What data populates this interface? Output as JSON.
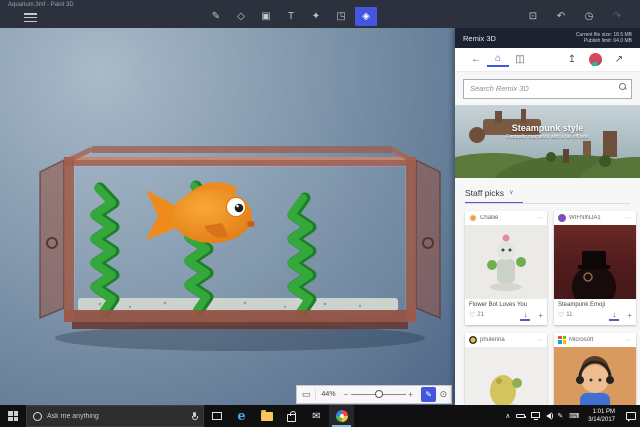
{
  "colors": {
    "accent": "#4456e0",
    "panel_accent": "#6454c8",
    "taskbar_active": "#76b9ed"
  },
  "window": {
    "title": "Aquarium.3mf - Paint 3D"
  },
  "topbar": {
    "tools": [
      {
        "name": "art-tools",
        "glyph": "✎",
        "active": false
      },
      {
        "name": "3d-shapes",
        "glyph": "◇",
        "active": false
      },
      {
        "name": "stickers",
        "glyph": "▣",
        "active": false
      },
      {
        "name": "text",
        "glyph": "T",
        "active": false
      },
      {
        "name": "effects",
        "glyph": "✦",
        "active": false
      },
      {
        "name": "canvas",
        "glyph": "◳",
        "active": false
      },
      {
        "name": "remix-3d",
        "glyph": "◈",
        "active": true
      }
    ],
    "actions": [
      {
        "name": "paste",
        "glyph": "⊡"
      },
      {
        "name": "undo",
        "glyph": "↶"
      },
      {
        "name": "history",
        "glyph": "◷"
      },
      {
        "name": "redo",
        "glyph": "↷"
      }
    ]
  },
  "canvas": {
    "zoom": "44%"
  },
  "zoombar": {
    "fit": "▭",
    "minus": "−",
    "plus": "+",
    "pencil": "✎",
    "eye": "⊙"
  },
  "remix": {
    "header": {
      "title": "Remix 3D",
      "file_size": "Current file size: 18.5 MB",
      "publish_limit": "Publish limit: 64.0 MB"
    },
    "nav": {
      "back": "←",
      "home": "⌂",
      "boards": "◫",
      "upload": "↥",
      "popout": "↗"
    },
    "search": {
      "placeholder": "Search Remix 3D"
    },
    "banner": {
      "title": "Steampunk style",
      "subtitle": "Fantastic machines with a far-off look"
    },
    "section": {
      "label": "Staff picks",
      "chevron": "∨"
    },
    "card_icons": {
      "heart": "♡",
      "download": "↓",
      "add": "+",
      "more": "⋯"
    },
    "cards": [
      {
        "user": "Challie",
        "title": "Flower Bot Loves You",
        "likes": "21"
      },
      {
        "user": "WIFNINJA1",
        "title": "Steampunk Emoji",
        "likes": "11"
      },
      {
        "user": "phulenna"
      },
      {
        "user": "Microsoft"
      }
    ]
  },
  "taskbar": {
    "search_placeholder": "Ask me anything",
    "edge_glyph": "e",
    "mail_glyph": "✉",
    "tray": {
      "chevron": "∧",
      "pen": "✎",
      "keyboard": "⌨"
    },
    "clock": {
      "time": "1:01 PM",
      "date": "3/14/2017"
    }
  }
}
